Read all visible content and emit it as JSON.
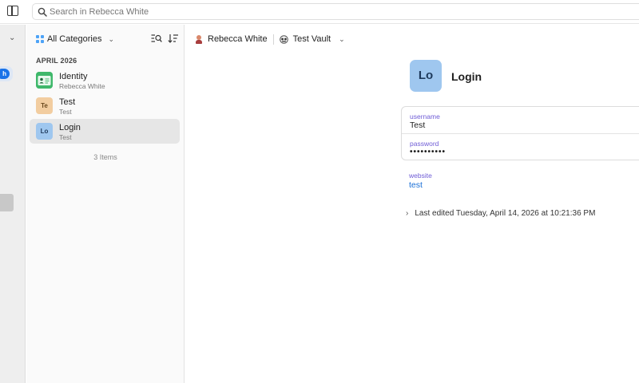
{
  "search": {
    "placeholder": "Search in Rebecca White",
    "value": ""
  },
  "rail": {
    "badge_glyph": "h"
  },
  "list": {
    "category_label": "All Categories",
    "section_header": "APRIL 2026",
    "items": [
      {
        "title": "Identity",
        "subtitle": "Rebecca White",
        "thumb": "",
        "kind": "identity-card-icon"
      },
      {
        "title": "Test",
        "subtitle": "Test",
        "thumb": "Te",
        "kind": "monogram"
      },
      {
        "title": "Login",
        "subtitle": "Test",
        "thumb": "Lo",
        "kind": "monogram",
        "selected": true
      }
    ],
    "count_label": "3 Items"
  },
  "detail": {
    "owner": "Rebecca White",
    "vault": "Test Vault",
    "thumb": "Lo",
    "title": "Login",
    "fields": [
      {
        "label": "username",
        "value": "Test"
      },
      {
        "label": "password",
        "value": "••••••••••"
      }
    ],
    "website": {
      "label": "website",
      "value": "test"
    },
    "last_edited": "Last edited Tuesday, April 14, 2026 at 10:21:36 PM"
  },
  "colors": {
    "accent_blue": "#1a73e8",
    "field_label": "#6f5cd6",
    "link": "#1a6fd6",
    "login_thumb": "#9fc7ef",
    "test_thumb": "#f2cda0",
    "identity_thumb": "#3fb86b"
  }
}
